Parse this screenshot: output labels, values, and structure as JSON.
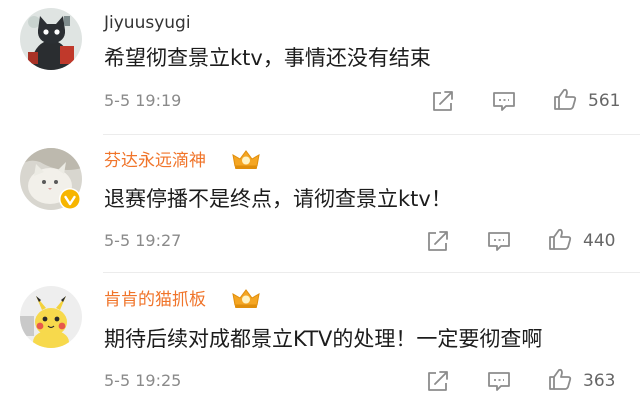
{
  "comments": [
    {
      "username": "Jiyuusyugi",
      "vip": false,
      "verified": false,
      "content": "希望彻查景立ktv，事情还没有结束",
      "time": "5-5 19:19",
      "likes": "561",
      "avatar_icon": "black-cat-cartoon-avatar"
    },
    {
      "username": "芬达永远滴神",
      "vip": true,
      "verified": true,
      "content": "退赛停播不是终点，请彻查景立ktv！",
      "time": "5-5 19:27",
      "likes": "440",
      "avatar_icon": "white-cat-photo-avatar"
    },
    {
      "username": "肯肯的猫抓板",
      "vip": true,
      "verified": false,
      "content": "期待后续对成都景立KTV的处理！一定要彻查啊",
      "time": "5-5 19:25",
      "likes": "363",
      "avatar_icon": "pikachu-avatar"
    }
  ],
  "icons": {
    "share": "share-icon",
    "comment": "comment-icon",
    "like": "thumbs-up-icon",
    "vip": "crown-badge-icon",
    "verified": "verified-v-badge-icon"
  },
  "colors": {
    "vip_name": "#f0742a",
    "crown": "#f5a623",
    "verified_badge": "#f7b500",
    "meta_text": "#8a8a8a"
  }
}
